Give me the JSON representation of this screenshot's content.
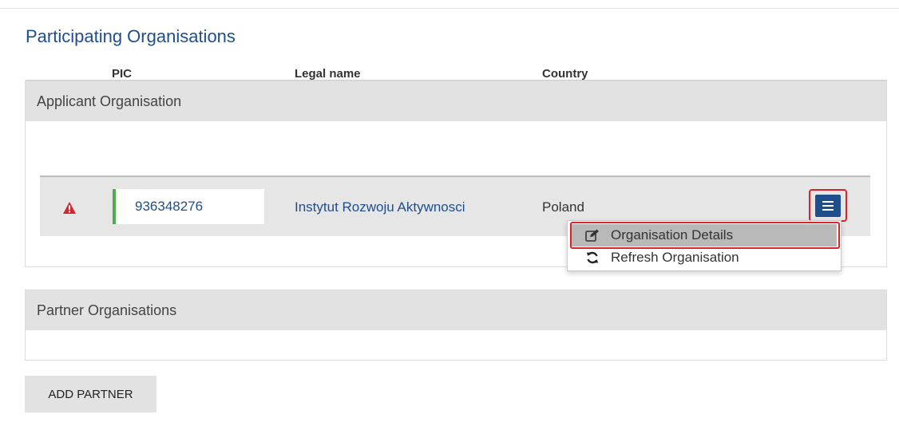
{
  "page": {
    "title": "Participating Organisations"
  },
  "applicant": {
    "header": "Applicant Organisation",
    "columns": {
      "pic": "PIC",
      "legal_name": "Legal name",
      "country": "Country"
    },
    "row": {
      "status_icon": "warning-triangle-icon",
      "pic": "936348276",
      "legal_name": "Instytut Rozwoju Aktywnosci",
      "country": "Poland",
      "menu_icon": "hamburger-menu-icon"
    },
    "menu": {
      "items": [
        {
          "label": "Organisation Details",
          "icon": "edit-icon",
          "highlighted": true
        },
        {
          "label": "Refresh Organisation",
          "icon": "refresh-icon",
          "highlighted": false
        }
      ]
    }
  },
  "partners": {
    "header": "Partner Organisations"
  },
  "actions": {
    "add_partner_label": "ADD PARTNER"
  },
  "colors": {
    "accent_blue": "#1f4e8c",
    "highlight_red": "#d9232d",
    "valid_green": "#4cae4c",
    "panel_header_grey": "#e2e2e2"
  }
}
